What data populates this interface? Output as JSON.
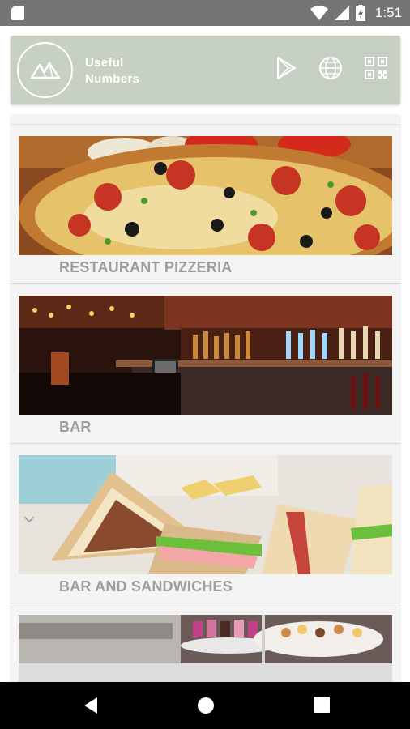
{
  "status_bar": {
    "time": "1:51",
    "icons": [
      "sd-card-icon",
      "wifi-icon",
      "signal-icon",
      "battery-charging-icon"
    ]
  },
  "header": {
    "title_line1": "Useful",
    "title_line2": "Numbers",
    "logo_icon": "mountain-logo-icon",
    "actions": [
      "play-store-icon",
      "globe-icon",
      "qr-code-icon"
    ],
    "background_color": "#c6d1c4"
  },
  "list": {
    "items": [
      {
        "label": "RESTAURANT PIZZERIA",
        "image": "pizza-photo"
      },
      {
        "label": "BAR",
        "image": "bar-counter-photo"
      },
      {
        "label": "BAR AND SANDWICHES",
        "image": "sandwiches-photo"
      },
      {
        "label": "",
        "image": "pastry-display-photo"
      }
    ]
  },
  "nav_bar": {
    "buttons": [
      "back-icon",
      "home-icon",
      "recents-icon"
    ]
  }
}
